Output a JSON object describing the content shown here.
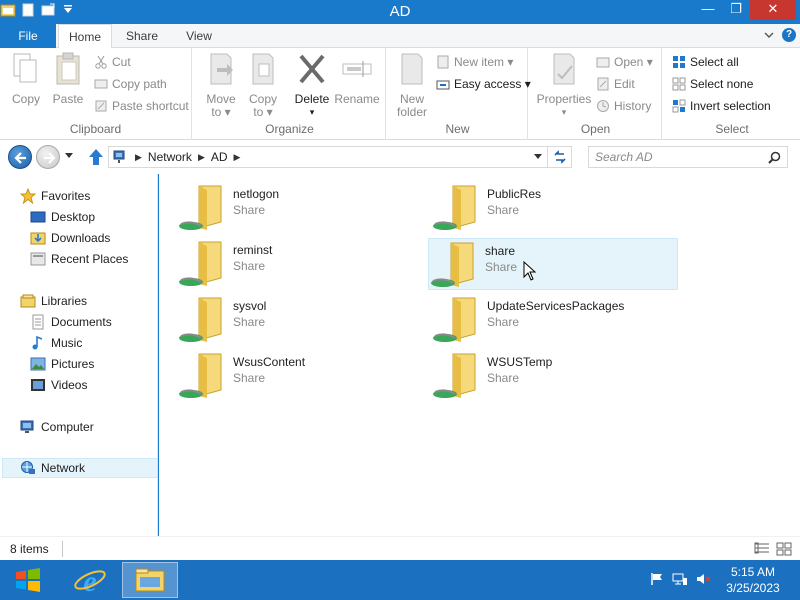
{
  "window": {
    "title": "AD",
    "buttons": {
      "minimize": "—",
      "maximize": "❐",
      "close": "✕"
    }
  },
  "ribbon_tabs": [
    {
      "label": "File"
    },
    {
      "label": "Home"
    },
    {
      "label": "Share"
    },
    {
      "label": "View"
    }
  ],
  "ribbon": {
    "clipboard": {
      "label": "Clipboard",
      "copy": "Copy",
      "paste": "Paste",
      "cut": "Cut",
      "copy_path": "Copy path",
      "paste_shortcut": "Paste shortcut"
    },
    "organize": {
      "label": "Organize",
      "move_to": "Move to",
      "copy_to": "Copy to",
      "delete": "Delete",
      "rename": "Rename"
    },
    "new": {
      "label": "New",
      "new_folder": "New folder",
      "new_item": "New item",
      "easy_access": "Easy access"
    },
    "open": {
      "label": "Open",
      "properties": "Properties",
      "open": "Open",
      "edit": "Edit",
      "history": "History"
    },
    "select": {
      "label": "Select",
      "select_all": "Select all",
      "select_none": "Select none",
      "invert_selection": "Invert selection"
    }
  },
  "address": {
    "crumbs": [
      "Network",
      "AD"
    ],
    "search_placeholder": "Search AD"
  },
  "nav": {
    "favorites": "Favorites",
    "desktop": "Desktop",
    "downloads": "Downloads",
    "recent_places": "Recent Places",
    "libraries": "Libraries",
    "documents": "Documents",
    "music": "Music",
    "pictures": "Pictures",
    "videos": "Videos",
    "computer": "Computer",
    "network": "Network"
  },
  "items": [
    {
      "name": "netlogon",
      "type": "Share"
    },
    {
      "name": "PublicRes",
      "type": "Share"
    },
    {
      "name": "reminst",
      "type": "Share"
    },
    {
      "name": "share",
      "type": "Share"
    },
    {
      "name": "sysvol",
      "type": "Share"
    },
    {
      "name": "UpdateServicesPackages",
      "type": "Share"
    },
    {
      "name": "WsusContent",
      "type": "Share"
    },
    {
      "name": "WSUSTemp",
      "type": "Share"
    }
  ],
  "status": {
    "item_count": "8 items"
  },
  "taskbar": {
    "time": "5:15 AM",
    "date": "3/25/2023"
  },
  "colors": {
    "accent": "#1979ca",
    "taskbar": "#1c70c0",
    "close": "#c7372f",
    "hover": "#e5f3fb"
  }
}
